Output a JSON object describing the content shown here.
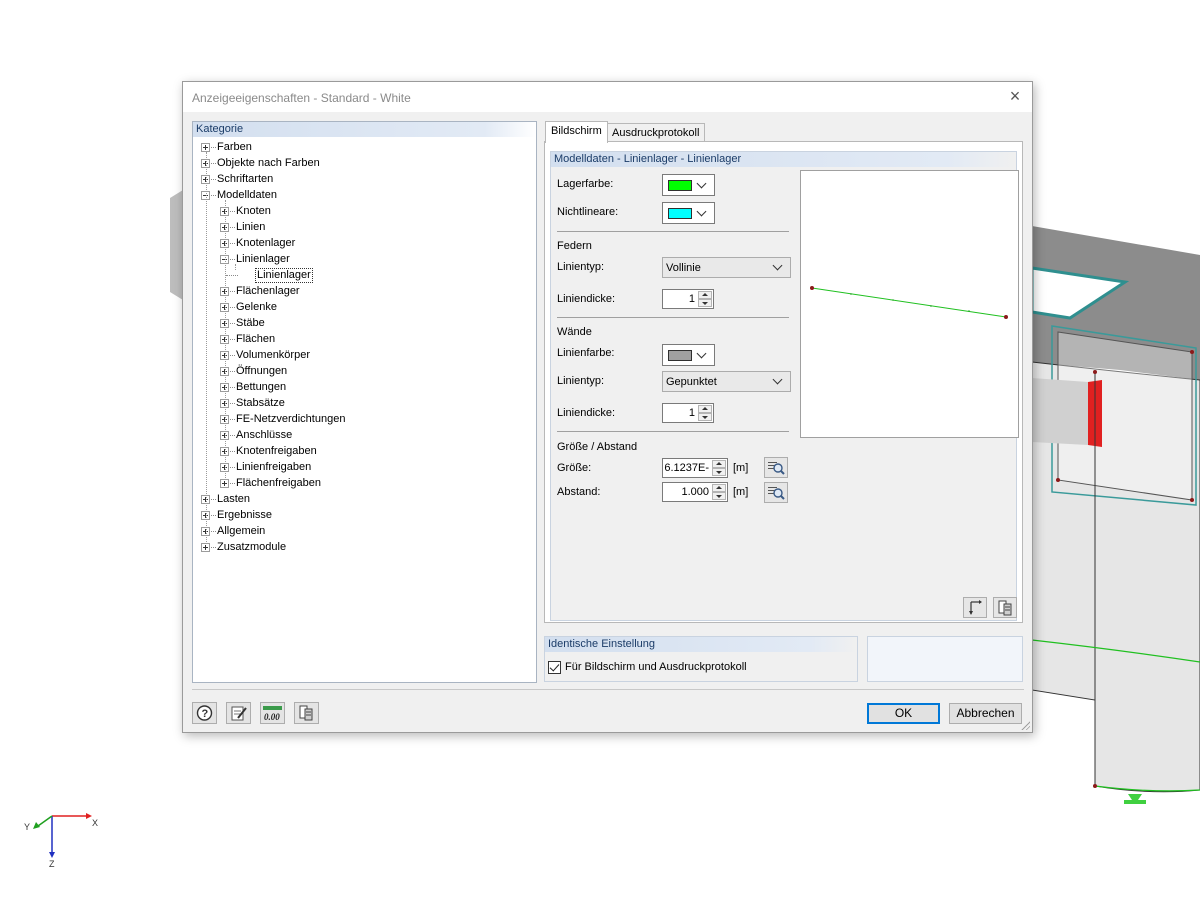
{
  "dialog": {
    "title": "Anzeigeeigenschaften - Standard - White",
    "close_icon": "×"
  },
  "tree": {
    "header": "Kategorie",
    "items": [
      {
        "label": "Farben",
        "level": 0,
        "state": "collapsed"
      },
      {
        "label": "Objekte nach Farben",
        "level": 0,
        "state": "collapsed"
      },
      {
        "label": "Schriftarten",
        "level": 0,
        "state": "collapsed"
      },
      {
        "label": "Modelldaten",
        "level": 0,
        "state": "expanded"
      },
      {
        "label": "Knoten",
        "level": 1,
        "state": "collapsed"
      },
      {
        "label": "Linien",
        "level": 1,
        "state": "collapsed"
      },
      {
        "label": "Knotenlager",
        "level": 1,
        "state": "collapsed"
      },
      {
        "label": "Linienlager",
        "level": 1,
        "state": "expanded"
      },
      {
        "label": "Linienlager",
        "level": 2,
        "state": "leaf",
        "selected": true
      },
      {
        "label": "Flächenlager",
        "level": 1,
        "state": "collapsed"
      },
      {
        "label": "Gelenke",
        "level": 1,
        "state": "collapsed"
      },
      {
        "label": "Stäbe",
        "level": 1,
        "state": "collapsed"
      },
      {
        "label": "Flächen",
        "level": 1,
        "state": "collapsed"
      },
      {
        "label": "Volumenkörper",
        "level": 1,
        "state": "collapsed"
      },
      {
        "label": "Öffnungen",
        "level": 1,
        "state": "collapsed"
      },
      {
        "label": "Bettungen",
        "level": 1,
        "state": "collapsed"
      },
      {
        "label": "Stabsätze",
        "level": 1,
        "state": "collapsed"
      },
      {
        "label": "FE-Netzverdichtungen",
        "level": 1,
        "state": "collapsed"
      },
      {
        "label": "Anschlüsse",
        "level": 1,
        "state": "collapsed"
      },
      {
        "label": "Knotenfreigaben",
        "level": 1,
        "state": "collapsed"
      },
      {
        "label": "Linienfreigaben",
        "level": 1,
        "state": "collapsed"
      },
      {
        "label": "Flächenfreigaben",
        "level": 1,
        "state": "collapsed"
      },
      {
        "label": "Lasten",
        "level": 0,
        "state": "collapsed"
      },
      {
        "label": "Ergebnisse",
        "level": 0,
        "state": "collapsed"
      },
      {
        "label": "Allgemein",
        "level": 0,
        "state": "collapsed"
      },
      {
        "label": "Zusatzmodule",
        "level": 0,
        "state": "collapsed"
      }
    ]
  },
  "tabs": [
    {
      "label": "Bildschirm",
      "active": true
    },
    {
      "label": "Ausdruckprotokoll",
      "active": false
    }
  ],
  "props": {
    "header": "Modelldaten - Linienlager - Linienlager",
    "lagerfarbe": {
      "label": "Lagerfarbe:",
      "color": "#00ff00"
    },
    "nichtlineare": {
      "label": "Nichtlineare:",
      "color": "#00ffff"
    },
    "federn": {
      "title": "Federn",
      "linientyp_label": "Linientyp:",
      "linientyp_value": "Vollinie",
      "liniendicke_label": "Liniendicke:",
      "liniendicke_value": "1"
    },
    "waende": {
      "title": "Wände",
      "linienfarbe_label": "Linienfarbe:",
      "linienfarbe_color": "#a0a0a0",
      "linientyp_label": "Linientyp:",
      "linientyp_value": "Gepunktet",
      "liniendicke_label": "Liniendicke:",
      "liniendicke_value": "1"
    },
    "groesse": {
      "title": "Größe / Abstand",
      "groesse_label": "Größe:",
      "groesse_value": "6.1237E-",
      "groesse_unit": "[m]",
      "abstand_label": "Abstand:",
      "abstand_value": "1.000",
      "abstand_unit": "[m]"
    }
  },
  "identical": {
    "header": "Identische Einstellung",
    "checkbox_label": "Für Bildschirm und Ausdruckprotokoll",
    "checked": true
  },
  "buttons": {
    "ok": "OK",
    "cancel": "Abbrechen"
  },
  "axes": {
    "x": "X",
    "y": "Y",
    "z": "Z"
  },
  "colors": {
    "accent_blue": "#0078d7",
    "header_text": "#1b3c68",
    "support_green": "#00ff00",
    "wall_red": "#e02020"
  }
}
